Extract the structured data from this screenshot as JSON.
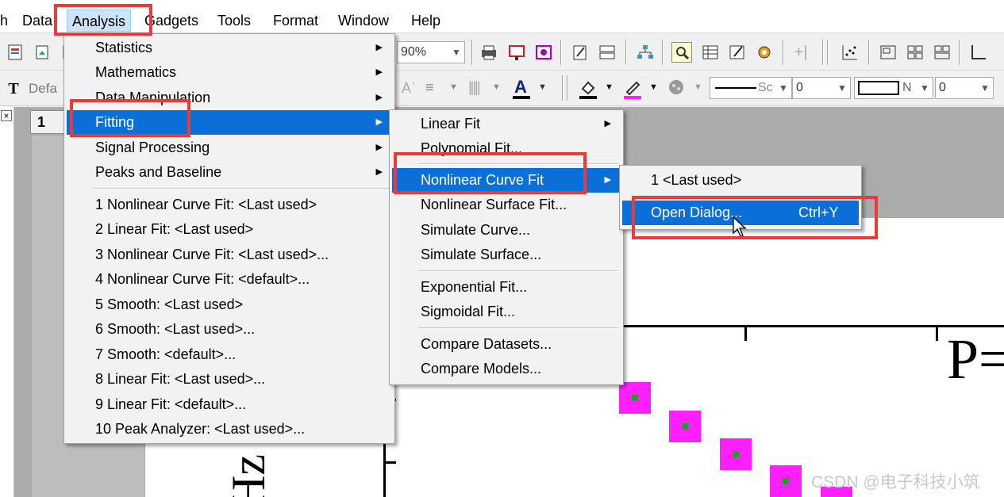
{
  "menubar": {
    "items": [
      "h",
      "Data",
      "Analysis",
      "Gadgets",
      "Tools",
      "Format",
      "Window",
      "Help"
    ],
    "active": "Analysis"
  },
  "toolbar": {
    "zoom_value": "90%",
    "font_name": "Defa",
    "line_style_value": "Sc",
    "line_width_value": "0",
    "border_value": "N",
    "border_width_value": "0"
  },
  "worksheet": {
    "tab_label": "1",
    "close_glyph": "×"
  },
  "analysis_menu": {
    "items": [
      "Statistics",
      "Mathematics",
      "Data Manipulation",
      "Fitting",
      "Signal Processing",
      "Peaks and Baseline"
    ],
    "recent": [
      "1 Nonlinear Curve Fit: <Last used>",
      "2 Linear Fit: <Last used>",
      "3 Nonlinear Curve Fit: <Last used>...",
      "4 Nonlinear Curve Fit: <default>...",
      "5 Smooth: <Last used>",
      "6 Smooth: <Last used>...",
      "7 Smooth: <default>...",
      "8 Linear Fit: <Last used>...",
      "9 Linear Fit: <default>...",
      "10 Peak Analyzer: <Last used>..."
    ],
    "highlighted": "Fitting"
  },
  "fitting_menu": {
    "items": [
      "Linear Fit",
      "Polynomial Fit...",
      "Nonlinear Curve Fit",
      "Nonlinear Surface Fit...",
      "Simulate Curve...",
      "Simulate Surface...",
      "Exponential Fit...",
      "Sigmoidal Fit...",
      "Compare Datasets...",
      "Compare Models..."
    ],
    "highlighted": "Nonlinear Curve Fit"
  },
  "nlfit_menu": {
    "last_used": "1 <Last used>",
    "open_dialog": "Open Dialog...",
    "shortcut": "Ctrl+Y"
  },
  "graph": {
    "label_p": "P=",
    "axis_label_fragment": "Hz"
  },
  "watermark": "CSDN @电子科技小筑",
  "colors": {
    "highlight": "#0a6fd6",
    "annotation_red": "#ea3b3b",
    "marker_fill": "#ff20ff",
    "marker_center": "#20a020"
  }
}
